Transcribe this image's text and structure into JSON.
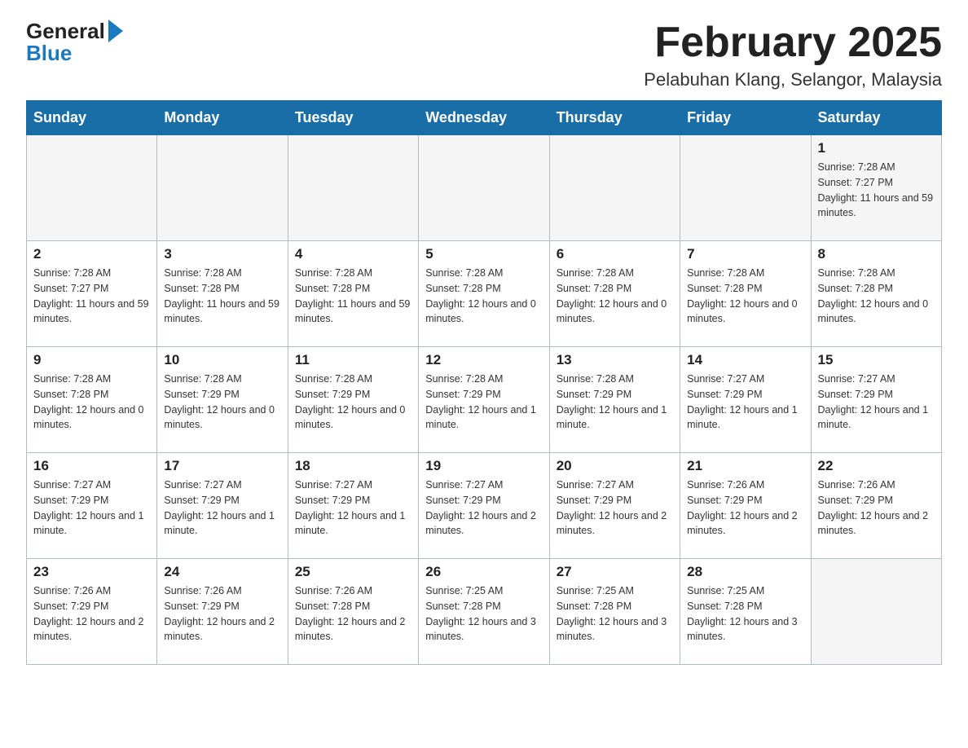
{
  "header": {
    "logo_general": "General",
    "logo_blue": "Blue",
    "month_title": "February 2025",
    "location": "Pelabuhan Klang, Selangor, Malaysia"
  },
  "weekdays": [
    "Sunday",
    "Monday",
    "Tuesday",
    "Wednesday",
    "Thursday",
    "Friday",
    "Saturday"
  ],
  "weeks": [
    [
      {
        "day": "",
        "info": ""
      },
      {
        "day": "",
        "info": ""
      },
      {
        "day": "",
        "info": ""
      },
      {
        "day": "",
        "info": ""
      },
      {
        "day": "",
        "info": ""
      },
      {
        "day": "",
        "info": ""
      },
      {
        "day": "1",
        "info": "Sunrise: 7:28 AM\nSunset: 7:27 PM\nDaylight: 11 hours and 59 minutes."
      }
    ],
    [
      {
        "day": "2",
        "info": "Sunrise: 7:28 AM\nSunset: 7:27 PM\nDaylight: 11 hours and 59 minutes."
      },
      {
        "day": "3",
        "info": "Sunrise: 7:28 AM\nSunset: 7:28 PM\nDaylight: 11 hours and 59 minutes."
      },
      {
        "day": "4",
        "info": "Sunrise: 7:28 AM\nSunset: 7:28 PM\nDaylight: 11 hours and 59 minutes."
      },
      {
        "day": "5",
        "info": "Sunrise: 7:28 AM\nSunset: 7:28 PM\nDaylight: 12 hours and 0 minutes."
      },
      {
        "day": "6",
        "info": "Sunrise: 7:28 AM\nSunset: 7:28 PM\nDaylight: 12 hours and 0 minutes."
      },
      {
        "day": "7",
        "info": "Sunrise: 7:28 AM\nSunset: 7:28 PM\nDaylight: 12 hours and 0 minutes."
      },
      {
        "day": "8",
        "info": "Sunrise: 7:28 AM\nSunset: 7:28 PM\nDaylight: 12 hours and 0 minutes."
      }
    ],
    [
      {
        "day": "9",
        "info": "Sunrise: 7:28 AM\nSunset: 7:28 PM\nDaylight: 12 hours and 0 minutes."
      },
      {
        "day": "10",
        "info": "Sunrise: 7:28 AM\nSunset: 7:29 PM\nDaylight: 12 hours and 0 minutes."
      },
      {
        "day": "11",
        "info": "Sunrise: 7:28 AM\nSunset: 7:29 PM\nDaylight: 12 hours and 0 minutes."
      },
      {
        "day": "12",
        "info": "Sunrise: 7:28 AM\nSunset: 7:29 PM\nDaylight: 12 hours and 1 minute."
      },
      {
        "day": "13",
        "info": "Sunrise: 7:28 AM\nSunset: 7:29 PM\nDaylight: 12 hours and 1 minute."
      },
      {
        "day": "14",
        "info": "Sunrise: 7:27 AM\nSunset: 7:29 PM\nDaylight: 12 hours and 1 minute."
      },
      {
        "day": "15",
        "info": "Sunrise: 7:27 AM\nSunset: 7:29 PM\nDaylight: 12 hours and 1 minute."
      }
    ],
    [
      {
        "day": "16",
        "info": "Sunrise: 7:27 AM\nSunset: 7:29 PM\nDaylight: 12 hours and 1 minute."
      },
      {
        "day": "17",
        "info": "Sunrise: 7:27 AM\nSunset: 7:29 PM\nDaylight: 12 hours and 1 minute."
      },
      {
        "day": "18",
        "info": "Sunrise: 7:27 AM\nSunset: 7:29 PM\nDaylight: 12 hours and 1 minute."
      },
      {
        "day": "19",
        "info": "Sunrise: 7:27 AM\nSunset: 7:29 PM\nDaylight: 12 hours and 2 minutes."
      },
      {
        "day": "20",
        "info": "Sunrise: 7:27 AM\nSunset: 7:29 PM\nDaylight: 12 hours and 2 minutes."
      },
      {
        "day": "21",
        "info": "Sunrise: 7:26 AM\nSunset: 7:29 PM\nDaylight: 12 hours and 2 minutes."
      },
      {
        "day": "22",
        "info": "Sunrise: 7:26 AM\nSunset: 7:29 PM\nDaylight: 12 hours and 2 minutes."
      }
    ],
    [
      {
        "day": "23",
        "info": "Sunrise: 7:26 AM\nSunset: 7:29 PM\nDaylight: 12 hours and 2 minutes."
      },
      {
        "day": "24",
        "info": "Sunrise: 7:26 AM\nSunset: 7:29 PM\nDaylight: 12 hours and 2 minutes."
      },
      {
        "day": "25",
        "info": "Sunrise: 7:26 AM\nSunset: 7:28 PM\nDaylight: 12 hours and 2 minutes."
      },
      {
        "day": "26",
        "info": "Sunrise: 7:25 AM\nSunset: 7:28 PM\nDaylight: 12 hours and 3 minutes."
      },
      {
        "day": "27",
        "info": "Sunrise: 7:25 AM\nSunset: 7:28 PM\nDaylight: 12 hours and 3 minutes."
      },
      {
        "day": "28",
        "info": "Sunrise: 7:25 AM\nSunset: 7:28 PM\nDaylight: 12 hours and 3 minutes."
      },
      {
        "day": "",
        "info": ""
      }
    ]
  ]
}
